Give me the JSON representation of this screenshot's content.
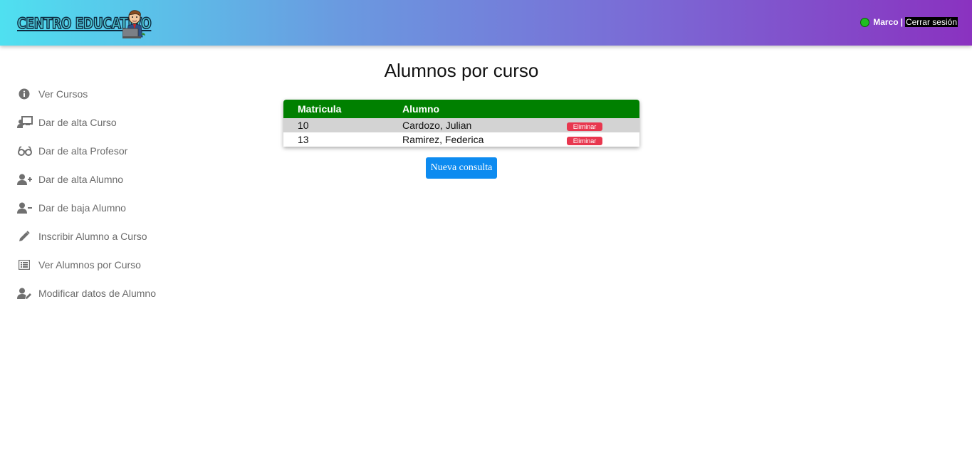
{
  "header": {
    "logo_text": "CENTRO EDUCATIVO",
    "user_name": "Marco",
    "separator": "|",
    "logout_label": "Cerrar sesión",
    "status_color": "#1fbf1f"
  },
  "sidebar": {
    "items": [
      {
        "label": "Ver Cursos",
        "icon": "info-circle-icon"
      },
      {
        "label": "Dar de alta Curso",
        "icon": "chalkboard-teacher-icon"
      },
      {
        "label": "Dar de alta Profesor",
        "icon": "glasses-icon"
      },
      {
        "label": "Dar de alta Alumno",
        "icon": "user-plus-icon"
      },
      {
        "label": "Dar de baja Alumno",
        "icon": "user-minus-icon"
      },
      {
        "label": "Inscribir Alumno a Curso",
        "icon": "pencil-icon"
      },
      {
        "label": "Ver Alumnos por Curso",
        "icon": "list-icon"
      },
      {
        "label": "Modificar datos de Alumno",
        "icon": "user-edit-icon"
      }
    ]
  },
  "main": {
    "title": "Alumnos por curso",
    "table": {
      "headers": [
        "Matricula",
        "Alumno"
      ],
      "rows": [
        {
          "matricula": "10",
          "alumno": "Cardozo, Julian",
          "action": "Eliminar"
        },
        {
          "matricula": "13",
          "alumno": "Ramirez, Federica",
          "action": "Eliminar"
        }
      ]
    },
    "new_query_label": "Nueva consulta"
  },
  "colors": {
    "table_header": "#008000",
    "delete_button": "#e8374f",
    "primary_button": "#0d8bf0"
  }
}
